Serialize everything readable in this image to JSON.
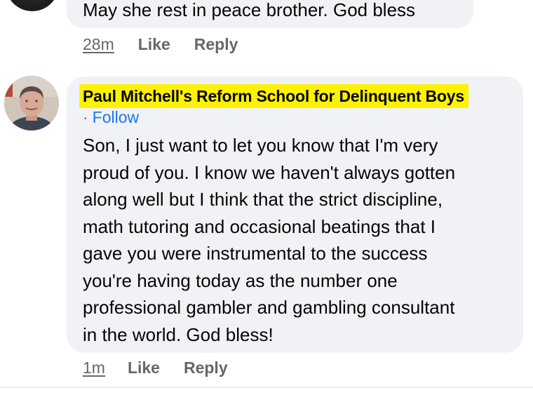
{
  "previous_comment": {
    "text": "May she rest in peace brother. God bless",
    "timestamp": "28m",
    "like_label": "Like",
    "reply_label": "Reply"
  },
  "comment": {
    "author": "Paul Mitchell's Reform School for Delinquent Boys",
    "separator": "·",
    "follow_label": "Follow",
    "text_lines": [
      "Son, I just want to let you know that I'm very",
      "proud of you. I know we haven't always gotten",
      "along well but I think that the strict discipline,",
      "math tutoring and occasional beatings that I",
      "gave you were instrumental to the success",
      "you're having today as the number one",
      "professional gambler and gambling consultant",
      "in the world. God bless!"
    ],
    "timestamp": "1m",
    "like_label": "Like",
    "reply_label": "Reply"
  },
  "colors": {
    "bubble": "#f0f2f5",
    "highlight": "#fff200",
    "follow_link": "#1877f2",
    "meta_text": "#65676b",
    "body_text": "#050505"
  }
}
